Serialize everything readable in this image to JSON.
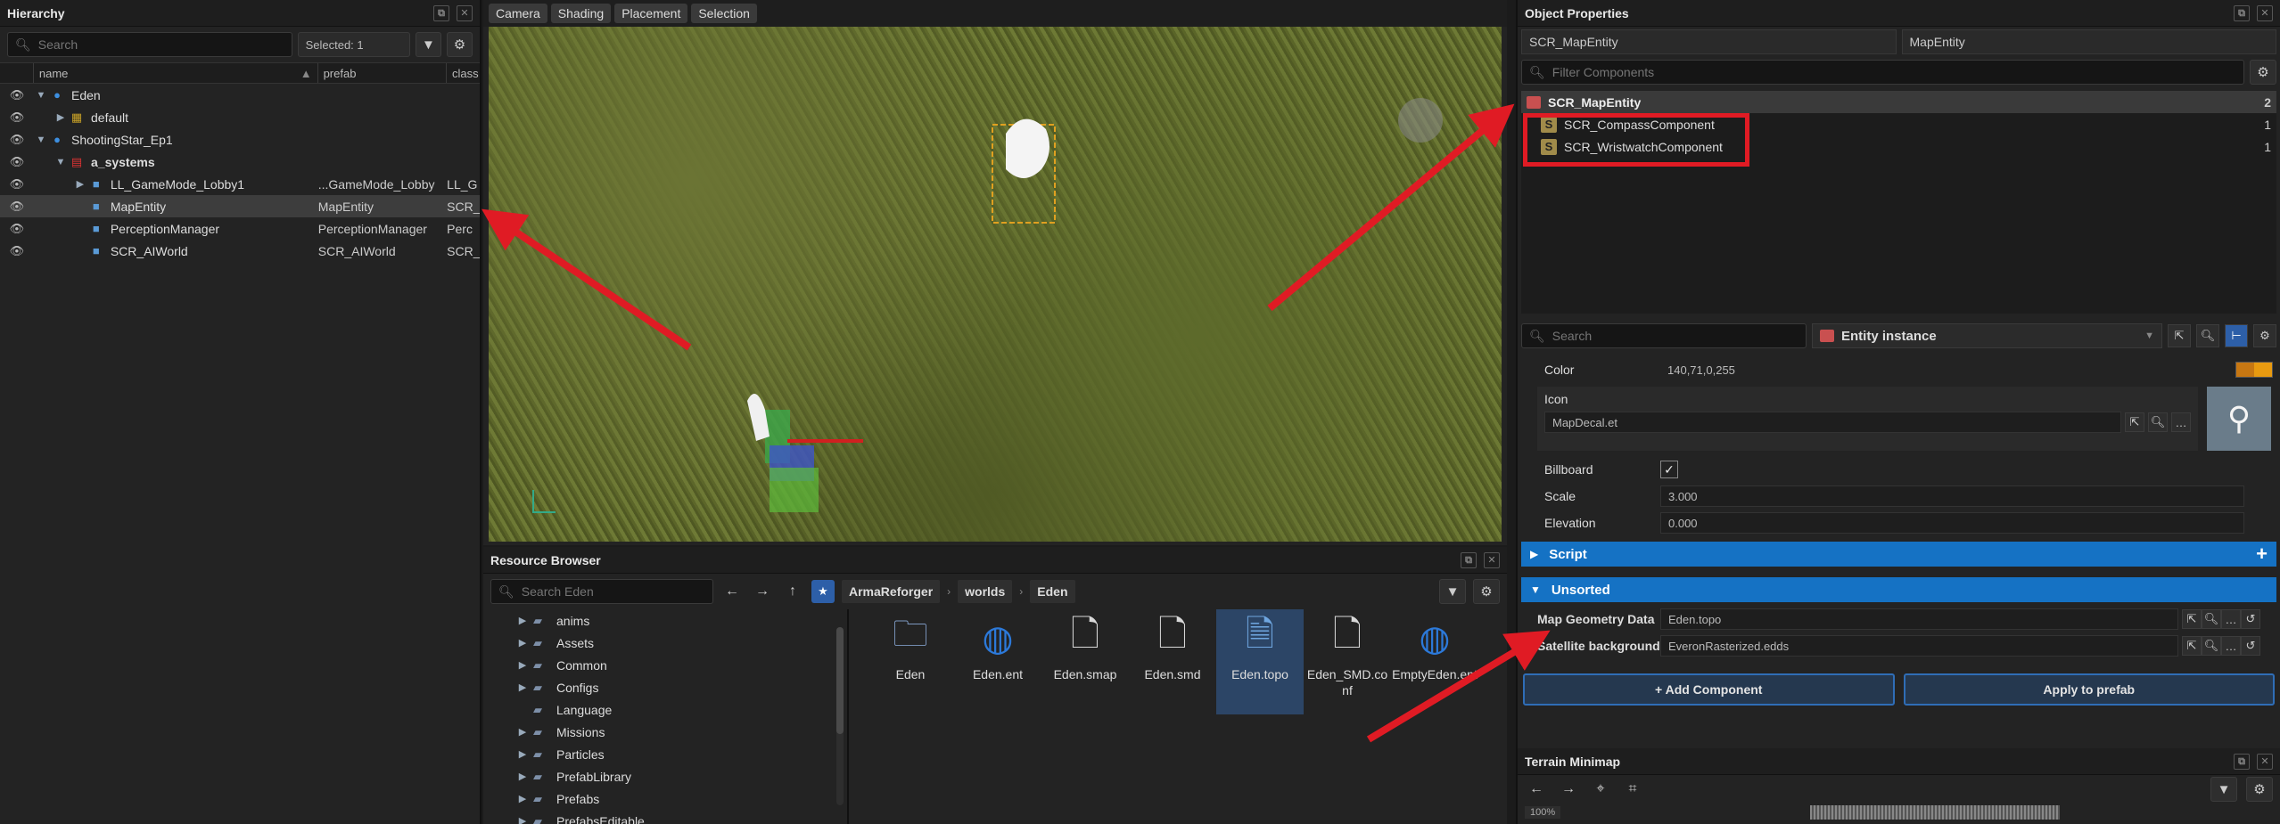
{
  "hierarchy": {
    "title": "Hierarchy",
    "search_placeholder": "Search",
    "selected_label": "Selected: 1",
    "columns": [
      "name",
      "prefab",
      "class"
    ],
    "rows": [
      {
        "name": "Eden",
        "prefab": "",
        "class": ""
      },
      {
        "name": "default",
        "prefab": "",
        "class": ""
      },
      {
        "name": "ShootingStar_Ep1",
        "prefab": "",
        "class": ""
      },
      {
        "name": "a_systems",
        "prefab": "",
        "class": ""
      },
      {
        "name": "LL_GameMode_Lobby1",
        "prefab": "...GameMode_Lobby",
        "class": "LL_G"
      },
      {
        "name": "MapEntity",
        "prefab": "MapEntity",
        "class": "SCR_"
      },
      {
        "name": "PerceptionManager",
        "prefab": "PerceptionManager",
        "class": "Perc"
      },
      {
        "name": "SCR_AIWorld",
        "prefab": "SCR_AIWorld",
        "class": "SCR_"
      }
    ]
  },
  "viewport": {
    "tabs": [
      "Camera",
      "Shading",
      "Placement",
      "Selection"
    ]
  },
  "resource_browser": {
    "title": "Resource Browser",
    "search_placeholder": "Search Eden",
    "breadcrumbs": [
      "ArmaReforger",
      "worlds",
      "Eden"
    ],
    "folders": [
      "anims",
      "Assets",
      "Common",
      "Configs",
      "Language",
      "Missions",
      "Particles",
      "PrefabLibrary",
      "Prefabs",
      "PrefabsEditable"
    ],
    "files": [
      {
        "name": "Eden",
        "type": "folder"
      },
      {
        "name": "Eden.ent",
        "type": "globe"
      },
      {
        "name": "Eden.smap",
        "type": "doc"
      },
      {
        "name": "Eden.smd",
        "type": "doc"
      },
      {
        "name": "Eden.topo",
        "type": "topo"
      },
      {
        "name": "Eden_SMD.conf",
        "type": "doc"
      },
      {
        "name": "EmptyEden.ent",
        "type": "globe"
      }
    ]
  },
  "object_properties": {
    "title": "Object Properties",
    "class_field": "SCR_MapEntity",
    "name_field": "MapEntity",
    "filter_placeholder": "Filter Components",
    "components": {
      "root": {
        "name": "SCR_MapEntity",
        "count": "2"
      },
      "children": [
        {
          "name": "SCR_CompassComponent",
          "count": "1"
        },
        {
          "name": "SCR_WristwatchComponent",
          "count": "1"
        }
      ]
    },
    "search_placeholder": "Search",
    "entity_instance": "Entity instance",
    "props": {
      "color_label": "Color",
      "color_value": "140,71,0,255",
      "icon_label": "Icon",
      "icon_value": "MapDecal.et",
      "billboard_label": "Billboard",
      "scale_label": "Scale",
      "scale_value": "3.000",
      "elevation_label": "Elevation",
      "elevation_value": "0.000"
    },
    "sections": {
      "script": "Script",
      "unsorted": "Unsorted"
    },
    "unsorted_props": {
      "map_geometry_label": "Map Geometry Data",
      "map_geometry_value": "Eden.topo",
      "satellite_label": "Satellite background",
      "satellite_value": "EveronRasterized.edds"
    },
    "add_component": "+ Add Component",
    "apply_prefab": "Apply to prefab"
  },
  "minimap": {
    "title": "Terrain Minimap",
    "zoom_label": "100%"
  },
  "colors": {
    "accent": "#1572c4",
    "annotation": "#e01b24",
    "color_swatch": "#8c4700"
  }
}
